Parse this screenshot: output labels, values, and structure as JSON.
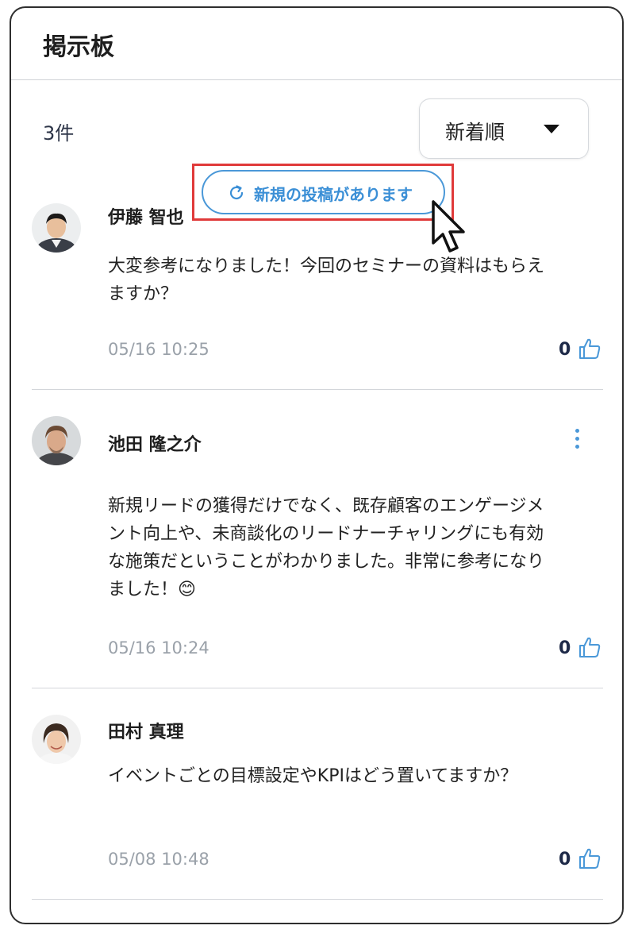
{
  "header": {
    "title": "掲示板"
  },
  "toolbar": {
    "count": "3件",
    "sort_label": "新着順"
  },
  "new_posts_banner": {
    "label": "新規の投稿があります",
    "icon": "refresh-icon"
  },
  "posts": [
    {
      "author": "伊藤 智也",
      "body": "大変参考になりました！今回のセミナーの資料はもらえますか？",
      "time": "05/16 10:25",
      "likes": "0"
    },
    {
      "author": "池田 隆之介",
      "body": "新規リードの獲得だけでなく、既存顧客のエンゲージメント向上や、未商談化のリードナーチャリングにも有効な施策だということがわかりました。非常に参考になりました！😊",
      "time": "05/16 10:24",
      "likes": "0"
    },
    {
      "author": "田村 真理",
      "body": "イベントごとの目標設定やKPIはどう置いてますか？",
      "time": "05/08 10:48",
      "likes": "0"
    }
  ],
  "colors": {
    "accent": "#4a98d8",
    "highlight": "#e03a3a",
    "text": "#1e1e1e",
    "muted": "#9aa1a9"
  }
}
